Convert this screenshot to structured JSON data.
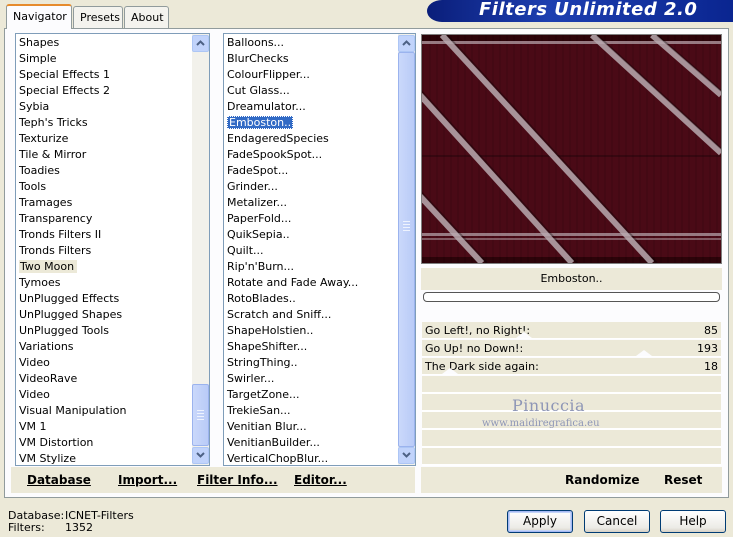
{
  "title": "Filters Unlimited 2.0",
  "tabs": [
    {
      "label": "Navigator"
    },
    {
      "label": "Presets"
    },
    {
      "label": "About"
    }
  ],
  "categories": {
    "items": [
      "Shapes",
      "Simple",
      "Special Effects 1",
      "Special Effects 2",
      "Sybia",
      "Teph's Tricks",
      "Texturize",
      "Tile & Mirror",
      "Toadies",
      "Tools",
      "Tramages",
      "Transparency",
      "Tronds Filters II",
      "Tronds Filters",
      "Two Moon",
      "Tymoes",
      "UnPlugged Effects",
      "UnPlugged Shapes",
      "UnPlugged Tools",
      "Variations",
      "Video",
      "VideoRave",
      "Video",
      "Visual Manipulation",
      "VM 1",
      "VM Distortion",
      "VM Stylize"
    ],
    "selected": "Two Moon"
  },
  "filters": {
    "items": [
      "Balloons...",
      "BlurChecks",
      "ColourFlipper...",
      "Cut Glass...",
      "Dreamulator...",
      "Emboston..",
      "EndageredSpecies",
      "FadeSpookSpot...",
      "FadeSpot...",
      "Grinder...",
      "Metalizer...",
      "PaperFold...",
      "QuikSepia..",
      "Quilt...",
      "Rip'n'Burn...",
      "Rotate and Fade Away...",
      "RotoBlades..",
      "Scratch and Sniff...",
      "ShapeHolstien..",
      "ShapeShifter...",
      "StringThing..",
      "Swirler...",
      "TargetZone...",
      "TrekieSan...",
      "Venitian Blur...",
      "VenitianBuilder...",
      "VerticalChopBlur..."
    ],
    "selected": "Emboston.."
  },
  "preview": {
    "filter_name": "Emboston..",
    "progress": 0,
    "colors": {
      "base": "#4a0a16",
      "dark": "#2c0309",
      "stripe": "#b9aab0"
    }
  },
  "params": [
    {
      "label": "Go Left!, no Right!:",
      "value": "85",
      "fraction": 0.333
    },
    {
      "label": "Go Up! no Down!:",
      "value": "193",
      "fraction": 0.757
    },
    {
      "label": "The Dark side again:",
      "value": "18",
      "fraction": 0.071
    }
  ],
  "watermark": {
    "name": "Pinuccia",
    "url": "www.maidiregrafica.eu"
  },
  "bottom_buttons": {
    "database": "Database",
    "import": "Import...",
    "filter_info": "Filter Info...",
    "editor": "Editor...",
    "randomize": "Randomize",
    "reset": "Reset"
  },
  "status": {
    "database_label": "Database:",
    "database_value": "ICNET-Filters",
    "filters_label": "Filters:",
    "filters_value": "1352"
  },
  "dialog_buttons": {
    "apply": "Apply",
    "cancel": "Cancel",
    "help": "Help"
  }
}
